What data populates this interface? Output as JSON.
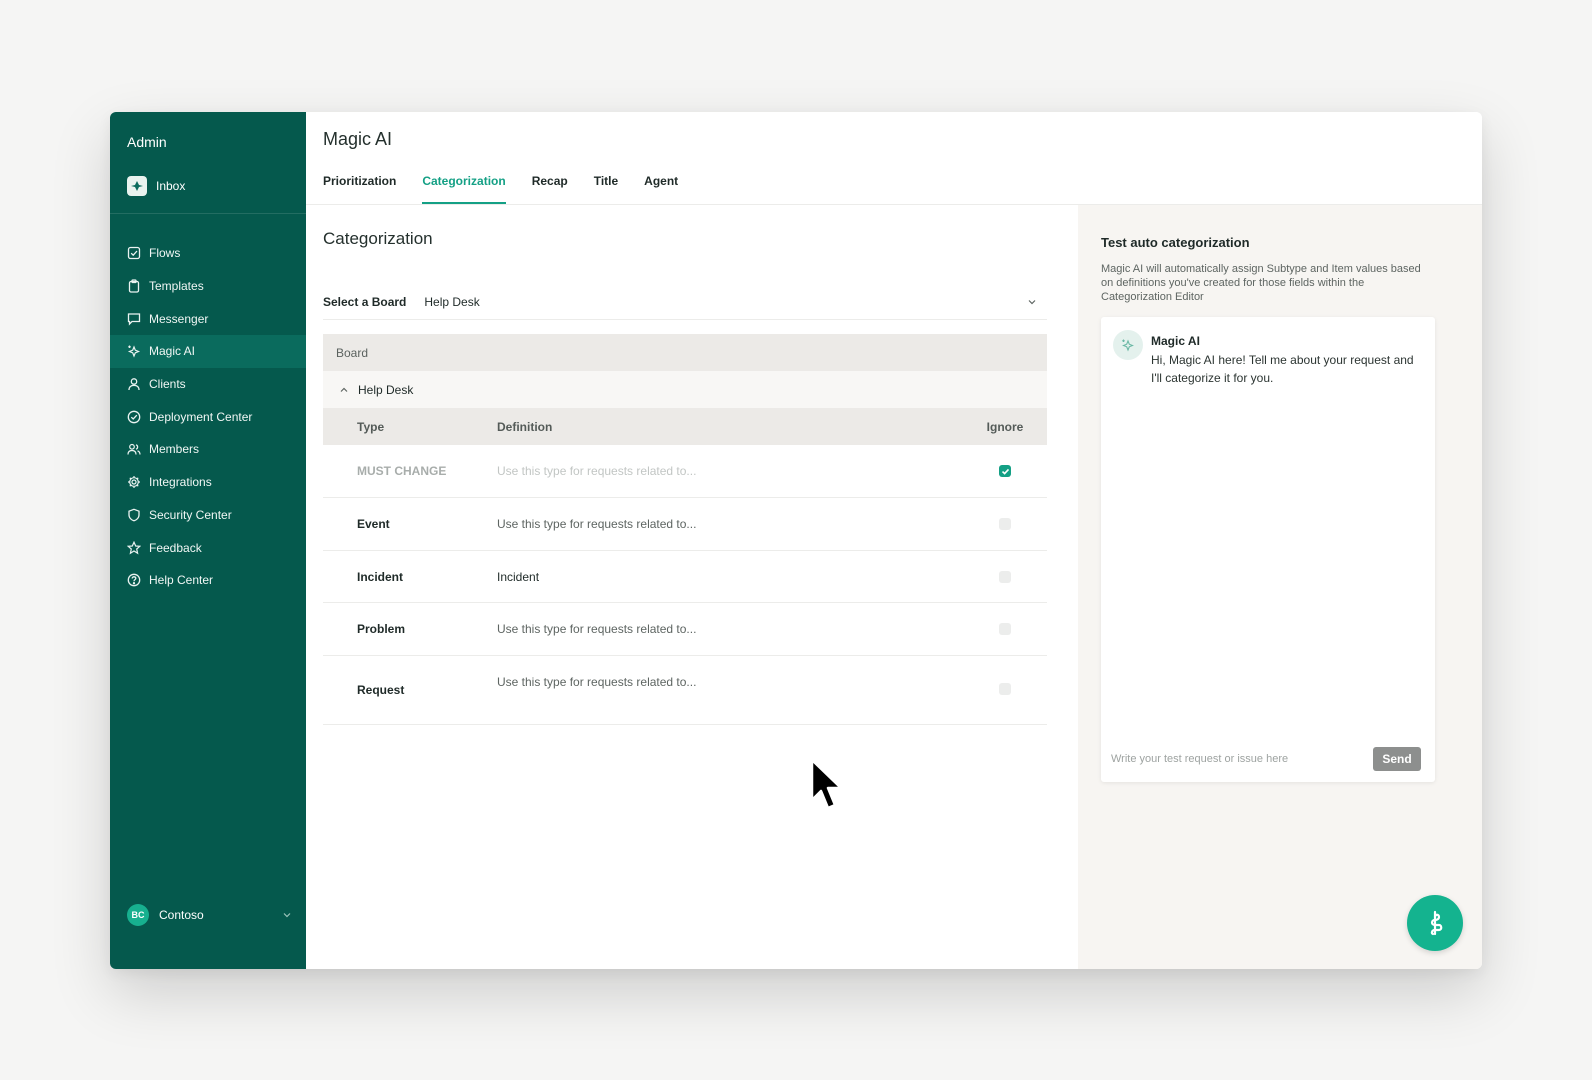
{
  "sidebar": {
    "title": "Admin",
    "inbox_label": "Inbox",
    "items": [
      {
        "label": "Flows",
        "icon": "check-square-icon"
      },
      {
        "label": "Templates",
        "icon": "clipboard-icon"
      },
      {
        "label": "Messenger",
        "icon": "message-icon"
      },
      {
        "label": "Magic AI",
        "icon": "sparkles-icon",
        "active": true
      },
      {
        "label": "Clients",
        "icon": "user-icon"
      },
      {
        "label": "Deployment Center",
        "icon": "check-circle-icon"
      },
      {
        "label": "Members",
        "icon": "users-icon"
      },
      {
        "label": "Integrations",
        "icon": "gear-icon"
      },
      {
        "label": "Security Center",
        "icon": "shield-icon"
      },
      {
        "label": "Feedback",
        "icon": "star-icon"
      },
      {
        "label": "Help Center",
        "icon": "help-circle-icon"
      }
    ],
    "footer": {
      "avatar_initials": "BC",
      "org_name": "Contoso"
    }
  },
  "header": {
    "title": "Magic AI",
    "tabs": [
      {
        "label": "Prioritization"
      },
      {
        "label": "Categorization",
        "active": true
      },
      {
        "label": "Recap"
      },
      {
        "label": "Title"
      },
      {
        "label": "Agent"
      }
    ]
  },
  "main": {
    "title": "Categorization",
    "board_select": {
      "label": "Select a Board",
      "value": "Help Desk"
    },
    "table": {
      "board_header": "Board",
      "group_name": "Help Desk",
      "columns": {
        "type": "Type",
        "definition": "Definition",
        "ignore": "Ignore"
      },
      "rows": [
        {
          "type": "MUST CHANGE",
          "definition": "Use this type for requests related to...",
          "ignored": true
        },
        {
          "type": "Event",
          "definition": "Use this type for requests related to...",
          "ignored": false
        },
        {
          "type": "Incident",
          "definition": "Incident",
          "ignored": false
        },
        {
          "type": "Problem",
          "definition": "Use this type for requests related to...",
          "ignored": false
        },
        {
          "type": "Request",
          "definition": "Use this type for requests related to...",
          "ignored": false
        }
      ]
    }
  },
  "test_panel": {
    "title": "Test auto categorization",
    "description": "Magic AI will automatically assign Subtype and Item values based on definitions you've created for those fields within the Categorization Editor",
    "message": {
      "sender": "Magic AI",
      "text": "Hi, Magic AI here! Tell me about your request and I'll categorize it for you."
    },
    "input_placeholder": "Write your test request or issue here",
    "send_label": "Send"
  },
  "colors": {
    "sidebar_bg": "#05594d",
    "accent": "#14a085",
    "fab": "#14b38f"
  }
}
